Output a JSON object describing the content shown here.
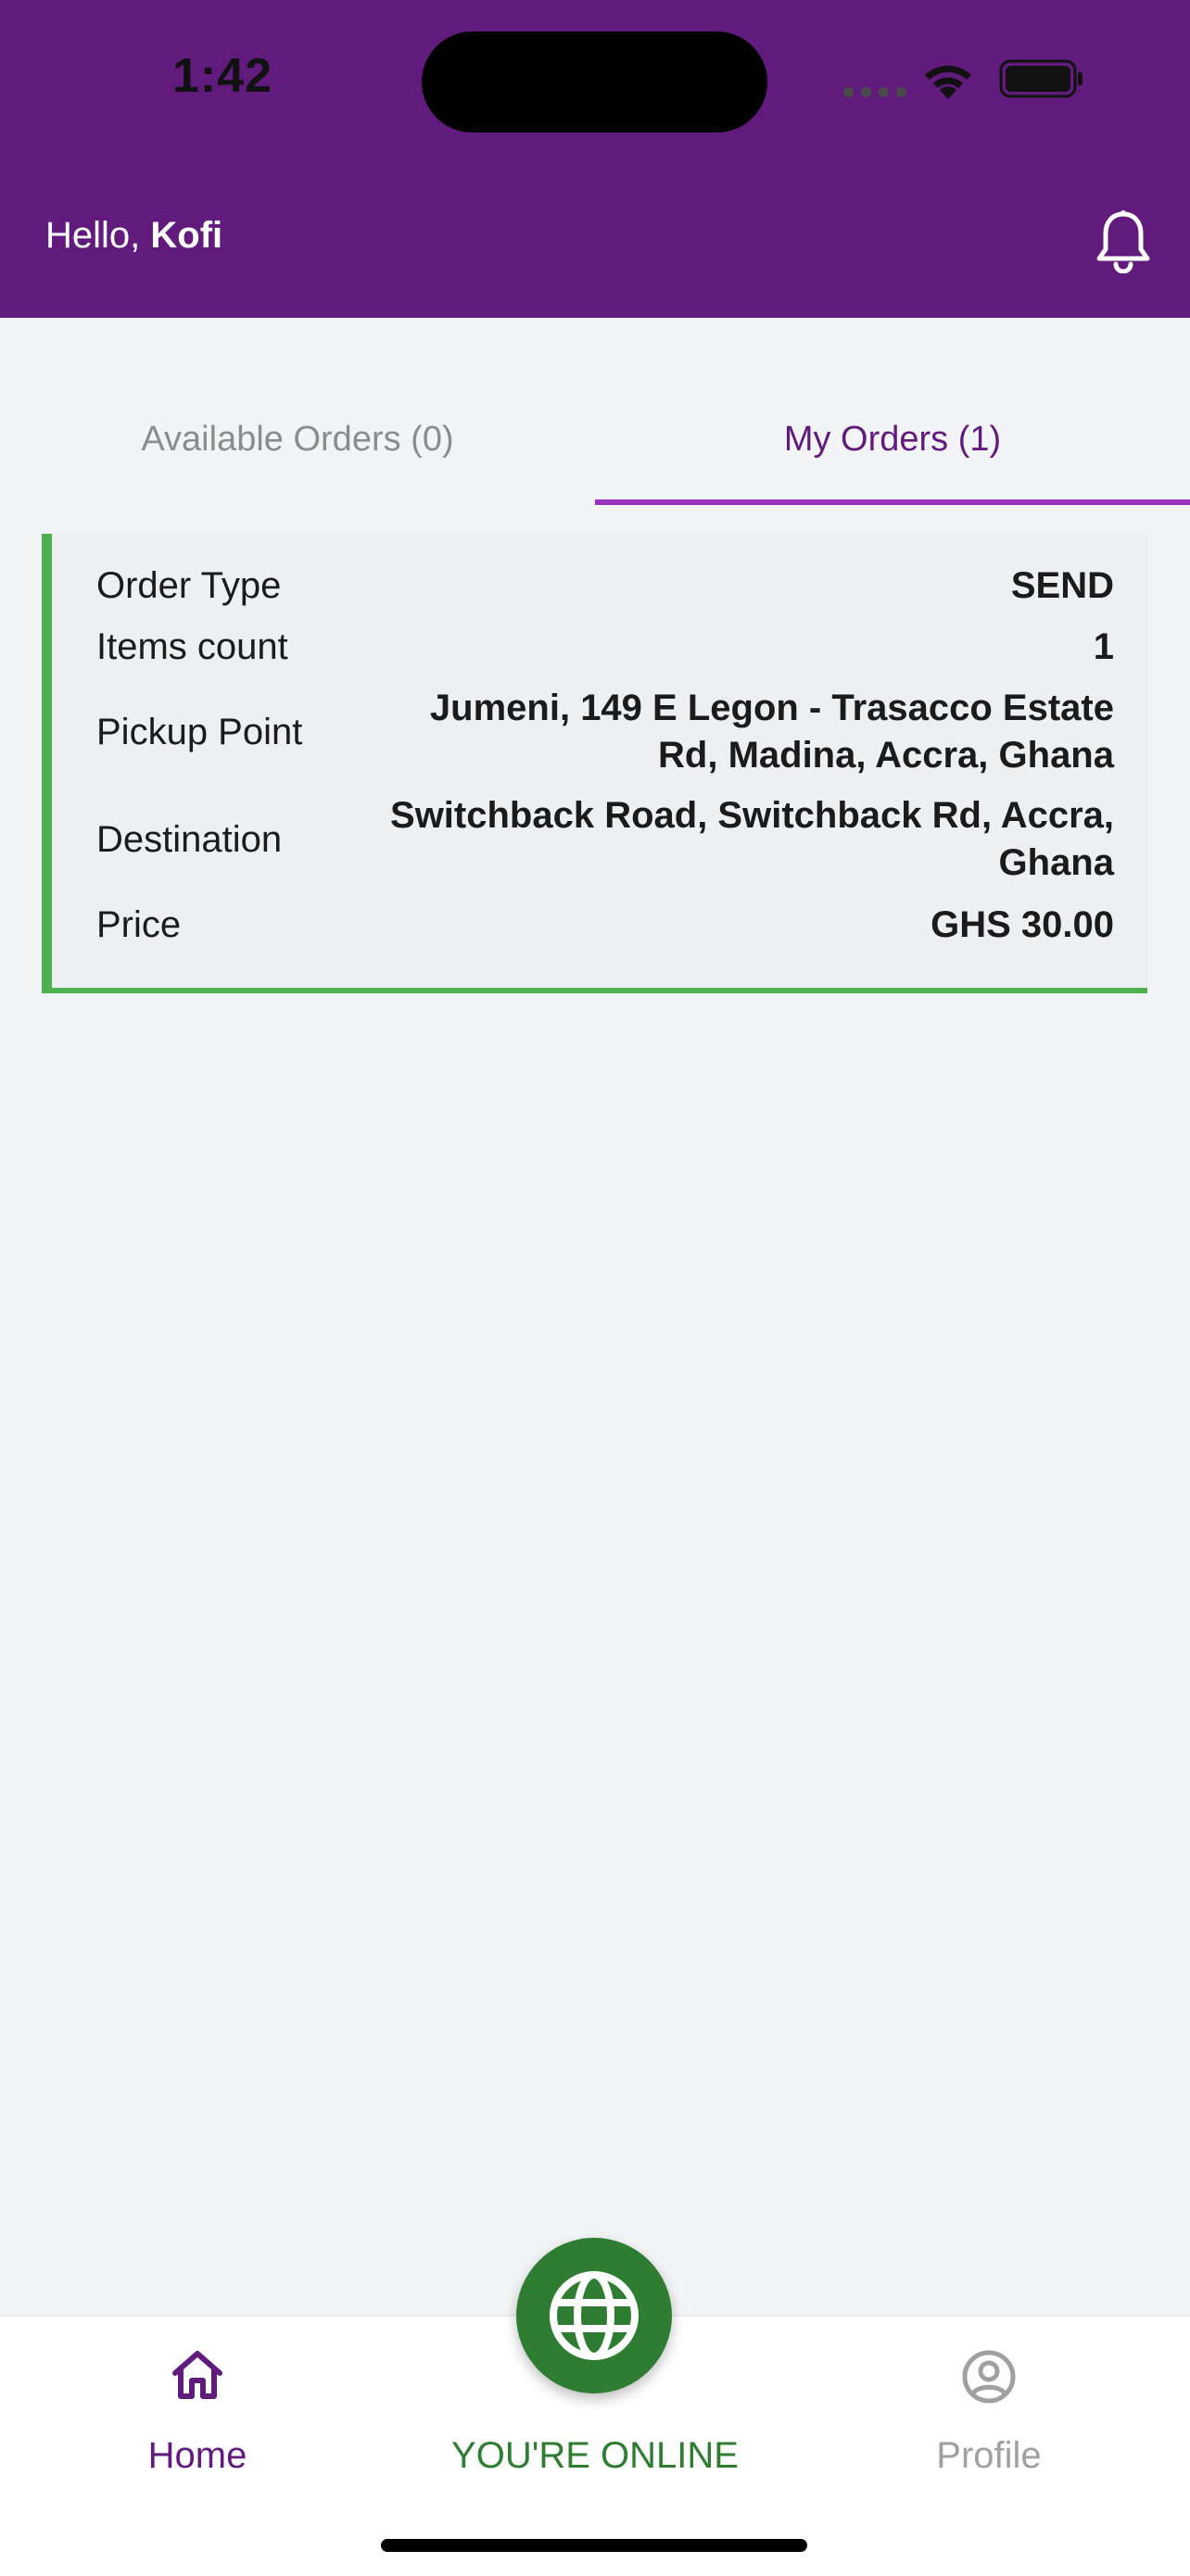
{
  "status_bar": {
    "time": "1:42"
  },
  "header": {
    "greeting_prefix": "Hello, ",
    "user_name": "Kofi",
    "icon": "bell-icon"
  },
  "tabs": [
    {
      "label": "Available Orders (0)",
      "active": false
    },
    {
      "label": "My Orders (1)",
      "active": true
    }
  ],
  "order": {
    "rows": [
      {
        "label": "Order Type",
        "value": "SEND"
      },
      {
        "label": "Items count",
        "value": "1"
      },
      {
        "label": "Pickup Point",
        "value": "Jumeni, 149 E Legon - Trasacco Estate Rd, Madina, Accra, Ghana"
      },
      {
        "label": "Destination",
        "value": "Switchback Road, Switchback Rd, Accra, Ghana"
      },
      {
        "label": "Price",
        "value": "GHS 30.00"
      }
    ],
    "accent_color": "#4cb14e"
  },
  "bottom_nav": {
    "home": {
      "label": "Home",
      "icon": "home-icon"
    },
    "online": {
      "label": "YOU'RE ONLINE",
      "icon": "globe-icon"
    },
    "profile": {
      "label": "Profile",
      "icon": "profile-icon"
    }
  },
  "colors": {
    "brand": "#611b7c",
    "tab_indicator": "#9b32bd",
    "online": "#2e7d32",
    "background": "#f3f4f6"
  }
}
